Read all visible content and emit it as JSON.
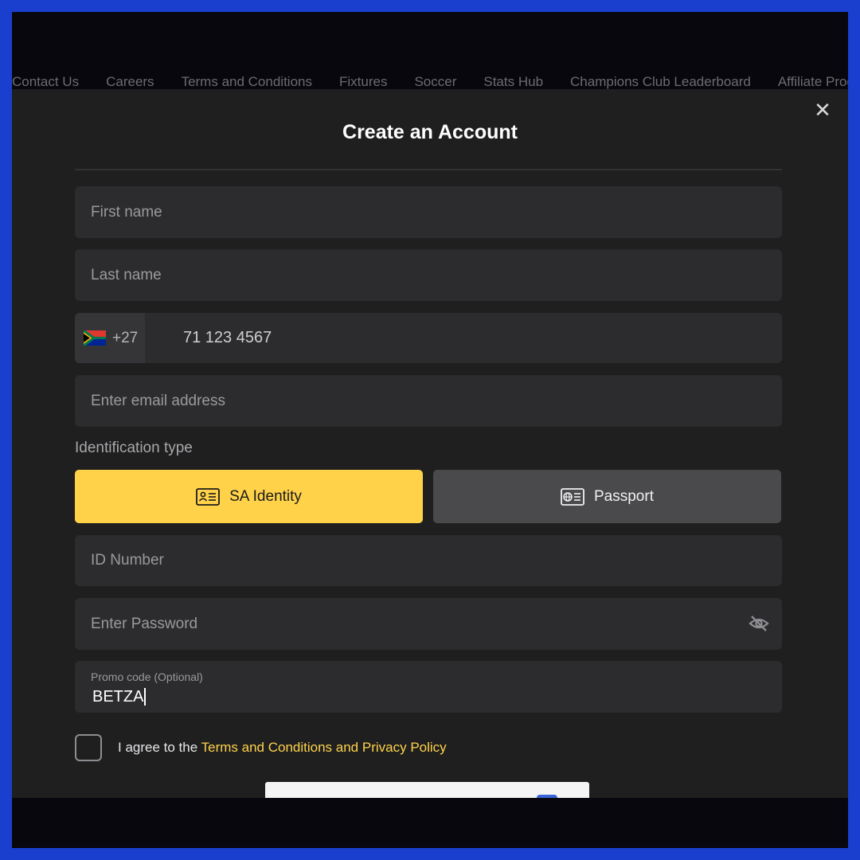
{
  "background_nav": {
    "links": [
      "Contact Us",
      "Careers",
      "Terms and Conditions",
      "Fixtures",
      "Soccer",
      "Stats Hub",
      "Champions Club Leaderboard",
      "Affiliate Program"
    ]
  },
  "modal": {
    "title": "Create an Account",
    "close_icon": "close-icon"
  },
  "form": {
    "first_name_placeholder": "First name",
    "last_name_placeholder": "Last name",
    "phone": {
      "country_flag": "south-africa-flag-icon",
      "country_code": "+27",
      "value": "71 123 4567"
    },
    "email_placeholder": "Enter email address",
    "identification_label": "Identification type",
    "id_types": {
      "sa_identity": {
        "label": "SA Identity",
        "icon": "id-card-icon",
        "selected": true
      },
      "passport": {
        "label": "Passport",
        "icon": "passport-icon",
        "selected": false
      }
    },
    "id_number_placeholder": "ID Number",
    "password_placeholder": "Enter Password",
    "password_toggle_icon": "eye-slash-icon",
    "promo": {
      "label": "Promo code (Optional)",
      "value": "BETZA"
    },
    "agree": {
      "prefix": "I agree to the",
      "link": "Terms and Conditions and Privacy Policy",
      "checked": false
    }
  },
  "colors": {
    "accent": "#ffd24a",
    "modal_bg": "#1f1f20",
    "field_bg": "#2c2c2e",
    "outer_border": "#1a3fcf"
  }
}
